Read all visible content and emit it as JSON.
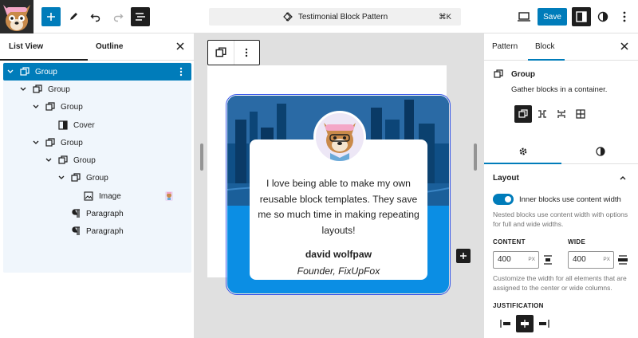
{
  "topbar": {
    "command_title": "Testimonial Block Pattern",
    "command_shortcut": "⌘K",
    "save_label": "Save"
  },
  "left_panel": {
    "tabs": [
      {
        "label": "List View",
        "active": true
      },
      {
        "label": "Outline",
        "active": false
      }
    ],
    "tree": [
      {
        "label": "Group",
        "icon": "group-icon",
        "expanded": true,
        "selected": true
      },
      {
        "label": "Group",
        "icon": "group-icon",
        "expanded": true
      },
      {
        "label": "Group",
        "icon": "group-icon",
        "expanded": true
      },
      {
        "label": "Cover",
        "icon": "cover-icon"
      },
      {
        "label": "Group",
        "icon": "group-icon",
        "expanded": true
      },
      {
        "label": "Group",
        "icon": "group-icon",
        "expanded": true
      },
      {
        "label": "Group",
        "icon": "group-icon",
        "expanded": true
      },
      {
        "label": "Image",
        "icon": "image-icon"
      },
      {
        "label": "Paragraph",
        "icon": "paragraph-icon"
      },
      {
        "label": "Paragraph",
        "icon": "paragraph-icon"
      }
    ]
  },
  "canvas": {
    "quote": "I love being able to make my own reusable block templates. They save me so much time in making repeating layouts!",
    "author": "david wolfpaw",
    "role": "Founder, FixUpFox"
  },
  "right_panel": {
    "tabs": [
      {
        "label": "Pattern",
        "active": false
      },
      {
        "label": "Block",
        "active": true
      }
    ],
    "block_title": "Group",
    "block_description": "Gather blocks in a container.",
    "layout": {
      "heading": "Layout",
      "toggle_label": "Inner blocks use content width",
      "toggle_on": true,
      "toggle_help": "Nested blocks use content width with options for full and wide widths.",
      "content_label": "CONTENT",
      "content_value": "400",
      "wide_label": "WIDE",
      "wide_value": "400",
      "unit": "PX",
      "width_help": "Customize the width for all elements that are assigned to the center or wide columns.",
      "justification_label": "JUSTIFICATION"
    }
  },
  "colors": {
    "accent": "#007cba",
    "dark": "#1e1e1e",
    "card_blue": "#0b8ee4",
    "selected_tree_bg": "#f0f6fc"
  }
}
